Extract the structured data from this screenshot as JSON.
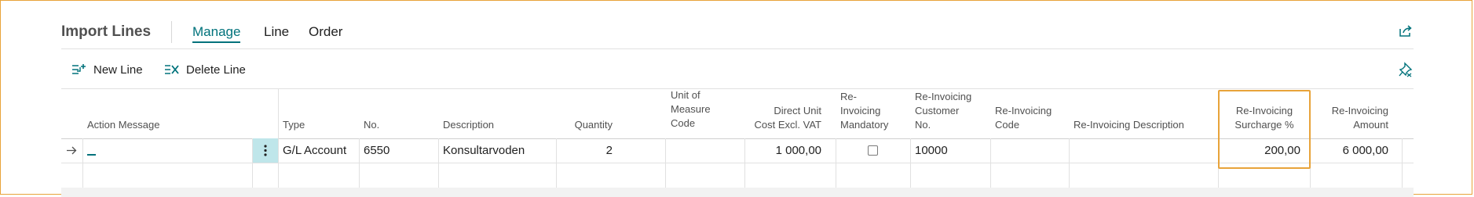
{
  "header": {
    "title": "Import Lines",
    "tabs": [
      {
        "label": "Manage",
        "active": true
      },
      {
        "label": "Line",
        "active": false
      },
      {
        "label": "Order",
        "active": false
      }
    ]
  },
  "actions": {
    "new_line": "New Line",
    "delete_line": "Delete Line"
  },
  "columns": {
    "action_message": "Action Message",
    "type": "Type",
    "no": "No.",
    "description": "Description",
    "quantity": "Quantity",
    "uom": [
      "Unit of",
      "Measure",
      "Code"
    ],
    "direct_unit_cost": [
      "Direct Unit",
      "Cost Excl. VAT"
    ],
    "reinv_mandatory": [
      "Re-",
      "Invoicing",
      "Mandatory"
    ],
    "reinv_customer": [
      "Re-Invoicing",
      "Customer",
      "No."
    ],
    "reinv_code": [
      "Re-Invoicing",
      "Code"
    ],
    "reinv_description": "Re-Invoicing Description",
    "reinv_surcharge": [
      "Re-Invoicing",
      "Surcharge %"
    ],
    "reinv_amount": [
      "Re-Invoicing",
      "Amount"
    ]
  },
  "rows": [
    {
      "action_message": "_",
      "type": "G/L Account",
      "no": "6550",
      "description": "Konsultarvoden",
      "quantity": "2",
      "uom": "",
      "direct_unit_cost": "1 000,00",
      "reinv_mandatory": false,
      "reinv_customer": "10000",
      "reinv_code": "",
      "reinv_description": "",
      "reinv_surcharge": "200,00",
      "reinv_amount": "6 000,00"
    }
  ],
  "colors": {
    "accent": "#00727b",
    "highlight": "#e8a33a",
    "selected_cell": "#bfe6ea"
  }
}
